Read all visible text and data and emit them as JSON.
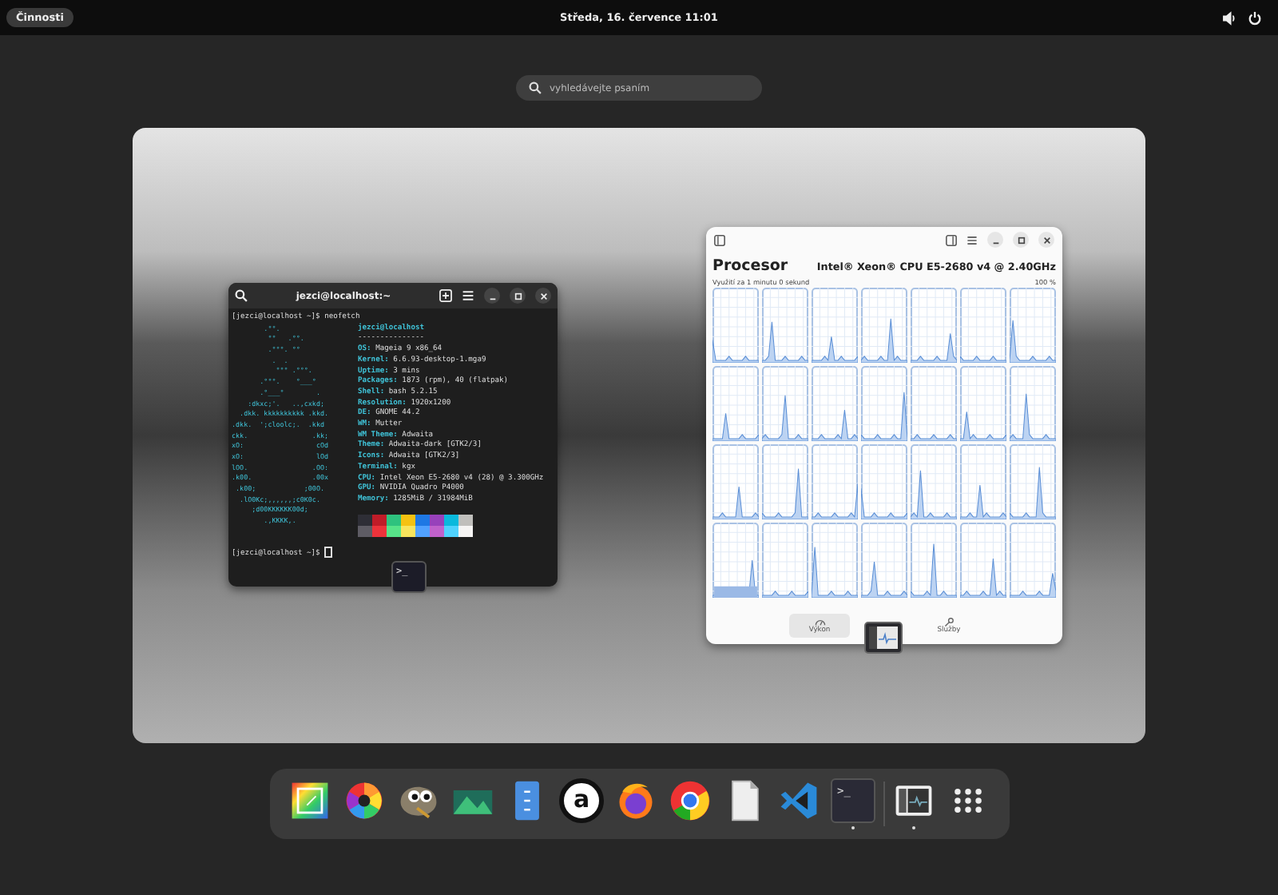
{
  "top_bar": {
    "activities_button": "Činnosti",
    "clock": "Středa, 16. července  11:01"
  },
  "search": {
    "placeholder": "vyhledávejte psaním"
  },
  "terminal": {
    "title": "jezci@localhost:~",
    "command_line": "[jezci@localhost ~]$ neofetch",
    "ascii_art": [
      "        .°°.",
      "         °°   .°°.",
      "         .°°°. °°",
      "          .  .",
      "           °°° .°°°.",
      "       .°°°.    °___°",
      "       .°___°        .",
      "    :dkxc;'.   ..,cxkd;",
      "  .dkk. kkkkkkkkkk .kkd.",
      ".dkk.  ';cloolc;.  .kkd",
      "ckk.                .kk;",
      "xO:                  cOd",
      "xO:                  lOd",
      "lOO.                .OO:",
      ".k00.               .00x",
      " .k00;            ;00O.",
      "  .lO0Kc;,,,,,,;c0K0c.",
      "     ;d00KKKKKK00d;",
      "        .,KKKK,."
    ],
    "user_host": "jezci@localhost",
    "separator": "---------------",
    "info": [
      {
        "label": "OS:",
        "value": "Mageia 9 x86_64"
      },
      {
        "label": "Kernel:",
        "value": "6.6.93-desktop-1.mga9"
      },
      {
        "label": "Uptime:",
        "value": "3 mins"
      },
      {
        "label": "Packages:",
        "value": "1873 (rpm), 40 (flatpak)"
      },
      {
        "label": "Shell:",
        "value": "bash 5.2.15"
      },
      {
        "label": "Resolution:",
        "value": "1920x1200"
      },
      {
        "label": "DE:",
        "value": "GNOME 44.2"
      },
      {
        "label": "WM:",
        "value": "Mutter"
      },
      {
        "label": "WM Theme:",
        "value": "Adwaita"
      },
      {
        "label": "Theme:",
        "value": "Adwaita-dark [GTK2/3]"
      },
      {
        "label": "Icons:",
        "value": "Adwaita [GTK2/3]"
      },
      {
        "label": "Terminal:",
        "value": "kgx"
      },
      {
        "label": "CPU:",
        "value": "Intel Xeon E5-2680 v4 (28) @ 3.300GHz"
      },
      {
        "label": "GPU:",
        "value": "NVIDIA Quadro P4000"
      },
      {
        "label": "Memory:",
        "value": "1285MiB / 31984MiB"
      }
    ],
    "palette": [
      [
        {
          "color": "#2e2e36"
        },
        {
          "color": "#c01c28"
        },
        {
          "color": "#2ec27e"
        },
        {
          "color": "#f5c211"
        },
        {
          "color": "#1e78e4"
        },
        {
          "color": "#9841bb"
        },
        {
          "color": "#0ab9dc"
        },
        {
          "color": "#c0bfbc"
        }
      ],
      [
        {
          "color": "#5e5c64"
        },
        {
          "color": "#ed333b"
        },
        {
          "color": "#57e389"
        },
        {
          "color": "#f8e45c"
        },
        {
          "color": "#51a1ff"
        },
        {
          "color": "#c061cb"
        },
        {
          "color": "#4fd2fd"
        },
        {
          "color": "#f6f5f4"
        }
      ]
    ],
    "prompt": "[jezci@localhost ~]$",
    "thumbnail_glyph": ">_"
  },
  "system_monitor": {
    "title": "Procesor",
    "cpu_model": "Intel® Xeon® CPU E5-2680 v4 @ 2.40GHz",
    "graph_caption": "Využití za 1 minutu 0 sekund",
    "graph_max": "100 %",
    "tabs": [
      {
        "label": "Výkon",
        "selected": true
      },
      {
        "label": "Služby",
        "selected": false
      }
    ]
  },
  "dock": [
    {
      "kind": "color-picker",
      "running": false
    },
    {
      "kind": "aperture",
      "running": false
    },
    {
      "kind": "mascot",
      "running": false
    },
    {
      "kind": "landscape",
      "running": false
    },
    {
      "kind": "cabinet",
      "running": false
    },
    {
      "kind": "letter",
      "glyph": "a",
      "running": false
    },
    {
      "kind": "fox",
      "running": false
    },
    {
      "kind": "browser",
      "running": false
    },
    {
      "kind": "document",
      "running": false
    },
    {
      "kind": "code",
      "running": false
    },
    {
      "kind": "terminal",
      "glyph": ">_",
      "running": true
    },
    {
      "kind": "monitor",
      "running": true
    },
    {
      "kind": "grid",
      "running": false
    }
  ]
}
